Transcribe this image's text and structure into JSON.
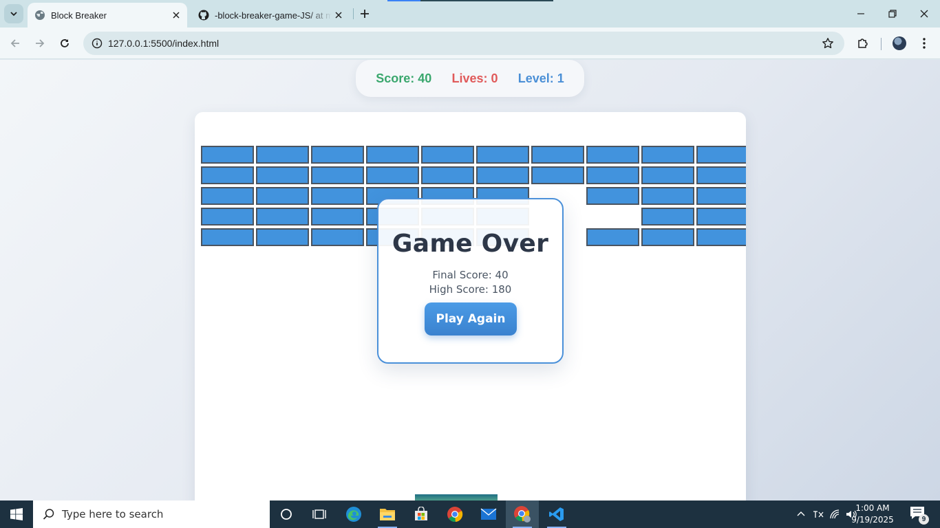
{
  "browser": {
    "tabs": [
      {
        "title": "Block Breaker",
        "active": true,
        "favicon": "globe-icon"
      },
      {
        "title": "-block-breaker-game-JS/ at main",
        "active": false,
        "favicon": "github-icon"
      }
    ],
    "url": "127.0.0.1:5500/index.html"
  },
  "game": {
    "score_text": "Score: 40",
    "lives_text": "Lives: 0",
    "level_text": "Level: 1",
    "bricks": [
      [
        1,
        1,
        1,
        1,
        1,
        1,
        1,
        1,
        1,
        1
      ],
      [
        1,
        1,
        1,
        1,
        1,
        1,
        1,
        1,
        1,
        1
      ],
      [
        1,
        1,
        1,
        1,
        1,
        1,
        0,
        1,
        1,
        1
      ],
      [
        1,
        1,
        1,
        1,
        1,
        1,
        0,
        0,
        1,
        1
      ],
      [
        1,
        1,
        1,
        1,
        1,
        1,
        0,
        1,
        1,
        1
      ]
    ],
    "colors": {
      "brick": "#4293dd",
      "score": "#3aa76d",
      "lives": "#e05a5a",
      "level": "#4a8fd6",
      "accent": "#4a90d9"
    }
  },
  "modal": {
    "title": "Game Over",
    "final_score": "Final Score: 40",
    "high_score": "High Score: 180",
    "button": "Play Again"
  },
  "taskbar": {
    "search_placeholder": "Type here to search",
    "time": "1:00 AM",
    "date": "9/19/2025",
    "notification_count": "9",
    "apps": [
      "task-view-icon",
      "edge-icon",
      "file-explorer-icon",
      "store-icon",
      "chrome-icon",
      "mail-icon",
      "chrome-profile-icon",
      "vscode-icon"
    ]
  }
}
